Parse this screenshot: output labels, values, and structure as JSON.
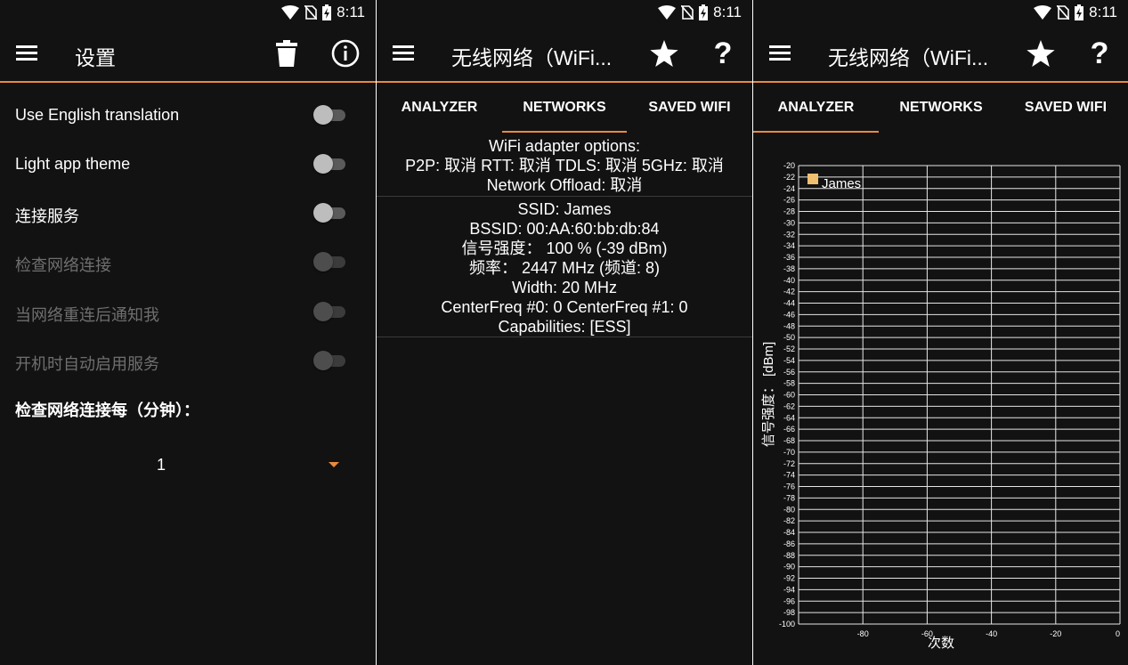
{
  "status": {
    "time": "8:11"
  },
  "settings_panel": {
    "title": "设置",
    "items": [
      {
        "label": "Use English translation",
        "enabled": true,
        "checked": false
      },
      {
        "label": "Light app theme",
        "enabled": true,
        "checked": false
      },
      {
        "label": "连接服务",
        "enabled": true,
        "checked": false
      },
      {
        "label": "检查网络连接",
        "enabled": false,
        "checked": false
      },
      {
        "label": "当网络重连后通知我",
        "enabled": false,
        "checked": false
      },
      {
        "label": "开机时自动启用服务",
        "enabled": false,
        "checked": false
      }
    ],
    "interval_label": "检查网络连接每（分钟）：",
    "interval_value": "1"
  },
  "networks_panel": {
    "title": "无线网络（WiFi...",
    "tabs": [
      "ANALYZER",
      "NETWORKS",
      "SAVED WIFI"
    ],
    "active_tab": "NETWORKS",
    "adapter": {
      "line1": "WiFi adapter options:",
      "line2": "P2P: 取消 RTT: 取消 TDLS: 取消 5GHz: 取消",
      "line3": "Network Offload: 取消"
    },
    "network": {
      "ssid": "SSID: James",
      "bssid": "BSSID: 00:AA:60:bb:db:84",
      "signal": "信号强度： 100 % (-39 dBm)",
      "frequency": "频率： 2447 MHz (频道: 8)",
      "width": "Width: 20 MHz",
      "center_freq": "CenterFreq #0: 0 CenterFreq #1: 0",
      "capabilities": "Capabilities: [ESS]"
    }
  },
  "analyzer_panel": {
    "title": "无线网络（WiFi...",
    "tabs": [
      "ANALYZER",
      "NETWORKS",
      "SAVED WIFI"
    ],
    "active_tab": "ANALYZER"
  },
  "colors": {
    "accent": "#e98a3d",
    "background": "#121212",
    "series": "#f0c070"
  },
  "chart_data": {
    "type": "line",
    "title": "",
    "xlabel": "次数",
    "ylabel": "信号强度： [dBm]",
    "xlim": [
      -100,
      0
    ],
    "ylim": [
      -100,
      -20
    ],
    "x_ticks": [
      -80,
      -60,
      -40,
      -20,
      0
    ],
    "y_ticks": [
      -20,
      -22,
      -24,
      -26,
      -28,
      -30,
      -32,
      -34,
      -36,
      -38,
      -40,
      -42,
      -44,
      -46,
      -48,
      -50,
      -52,
      -54,
      -56,
      -58,
      -60,
      -62,
      -64,
      -66,
      -68,
      -70,
      -72,
      -74,
      -76,
      -78,
      -80,
      -82,
      -84,
      -86,
      -88,
      -90,
      -92,
      -94,
      -96,
      -98,
      -100
    ],
    "grid": true,
    "legend_placement": "top-left",
    "series": [
      {
        "name": "James",
        "values": []
      }
    ]
  }
}
